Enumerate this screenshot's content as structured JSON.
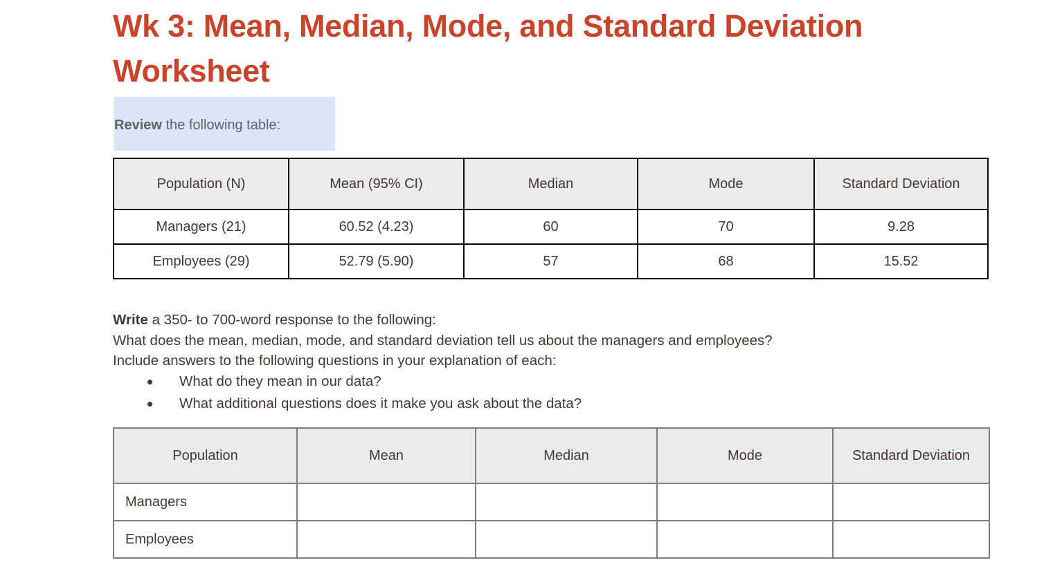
{
  "document": {
    "title": "Wk 3: Mean, Median, Mode, and Standard Deviation Worksheet",
    "title_color": "#c9442a",
    "body_text_color": "#463833"
  },
  "review_callout": {
    "lead_label": "Review",
    "text": " the following table:",
    "highlight_color": "#dbe5f6",
    "text_color": "#5f6368"
  },
  "data_table": {
    "header_bg": "#ebebeb",
    "border_color": "#0a0a0a",
    "columns": [
      "Population (N)",
      "Mean (95% CI)",
      "Median",
      "Mode",
      "Standard Deviation"
    ],
    "rows": [
      {
        "population": "Managers (21)",
        "mean": "60.52 (4.23)",
        "median": "60",
        "mode": "70",
        "sd": "9.28"
      },
      {
        "population": "Employees (29)",
        "mean": "52.79 (5.90)",
        "median": "57",
        "mode": "68",
        "sd": "15.52"
      }
    ]
  },
  "instructions": {
    "lead_label": "Write",
    "lead_rest": " a 350- to 700-word response to the following:",
    "line2": "What does the mean, median, mode, and standard deviation tell us about the managers and employees?",
    "line3": "Include answers to the following questions in your explanation of each:",
    "bullets": [
      "What do they mean in our data?",
      "What additional questions does it make you ask about the data?"
    ]
  },
  "answer_table": {
    "header_bg": "#ebebeb",
    "border_color": "#7d7d7d",
    "columns": [
      "Population",
      "Mean",
      "Median",
      "Mode",
      "Standard Deviation"
    ],
    "rows": [
      {
        "population": "Managers",
        "mean": "",
        "median": "",
        "mode": "",
        "sd": ""
      },
      {
        "population": "Employees",
        "mean": "",
        "median": "",
        "mode": "",
        "sd": ""
      }
    ]
  }
}
